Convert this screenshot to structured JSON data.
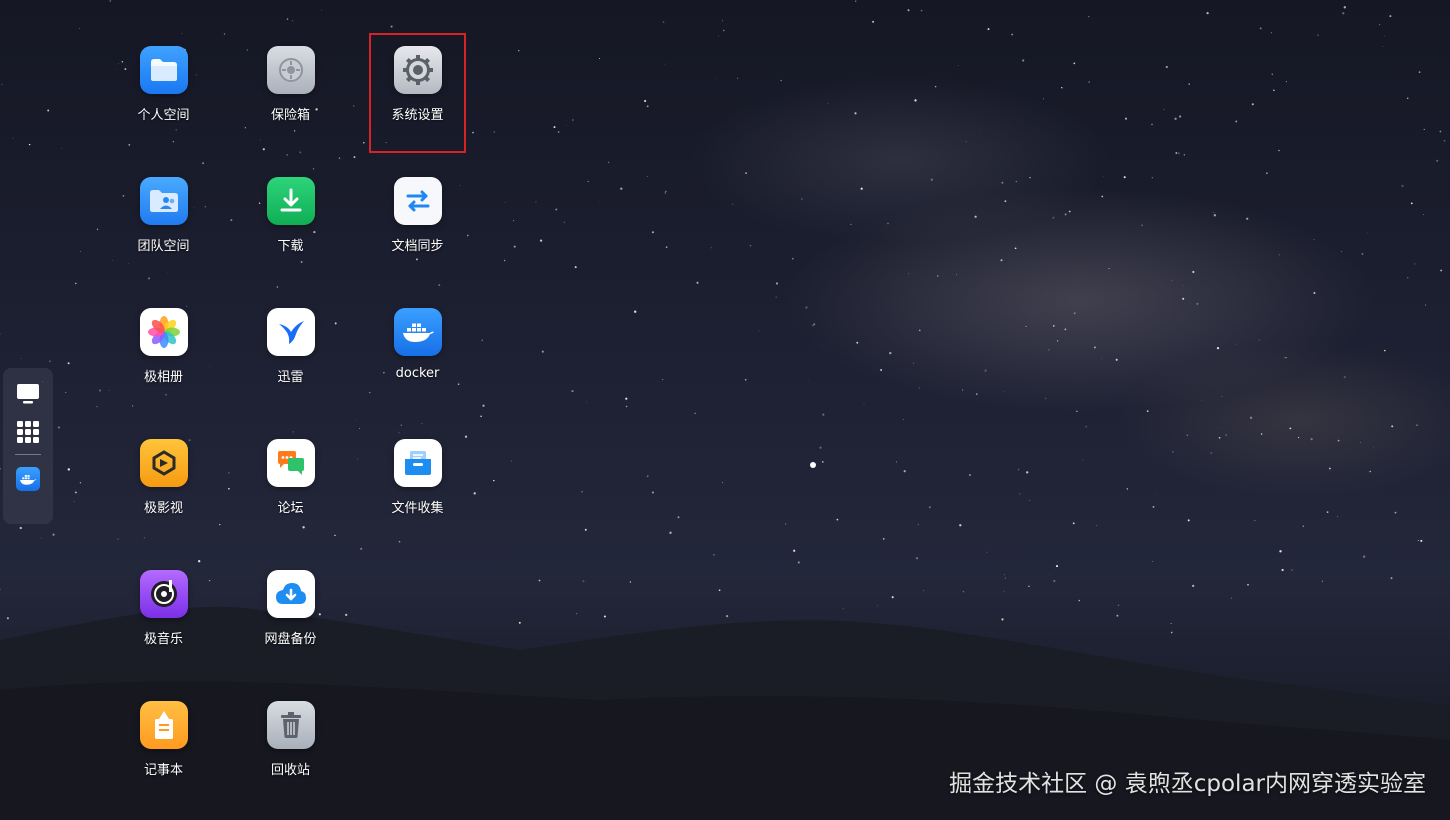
{
  "apps": [
    {
      "label": "个人空间",
      "icon": "folder-icon"
    },
    {
      "label": "保险箱",
      "icon": "safe-icon"
    },
    {
      "label": "系统设置",
      "icon": "gear-icon",
      "highlighted": true
    },
    {
      "label": "团队空间",
      "icon": "team-folder-icon"
    },
    {
      "label": "下载",
      "icon": "download-icon"
    },
    {
      "label": "文档同步",
      "icon": "sync-icon"
    },
    {
      "label": "极相册",
      "icon": "photos-icon"
    },
    {
      "label": "迅雷",
      "icon": "thunder-bird-icon"
    },
    {
      "label": "docker",
      "icon": "docker-icon"
    },
    {
      "label": "极影视",
      "icon": "video-icon"
    },
    {
      "label": "论坛",
      "icon": "forum-chat-icon"
    },
    {
      "label": "文件收集",
      "icon": "file-collect-icon"
    },
    {
      "label": "极音乐",
      "icon": "music-icon"
    },
    {
      "label": "网盘备份",
      "icon": "cloud-backup-icon"
    },
    {
      "label": "记事本",
      "icon": "notepad-icon"
    },
    {
      "label": "回收站",
      "icon": "trash-icon"
    }
  ],
  "dock": [
    {
      "name": "desktop-icon"
    },
    {
      "name": "app-grid-icon"
    },
    {
      "name": "docker-icon"
    }
  ],
  "watermark": "掘金技术社区 @ 袁煦丞cpolar内网穿透实验室",
  "colors": {
    "highlight": "#d62424"
  }
}
